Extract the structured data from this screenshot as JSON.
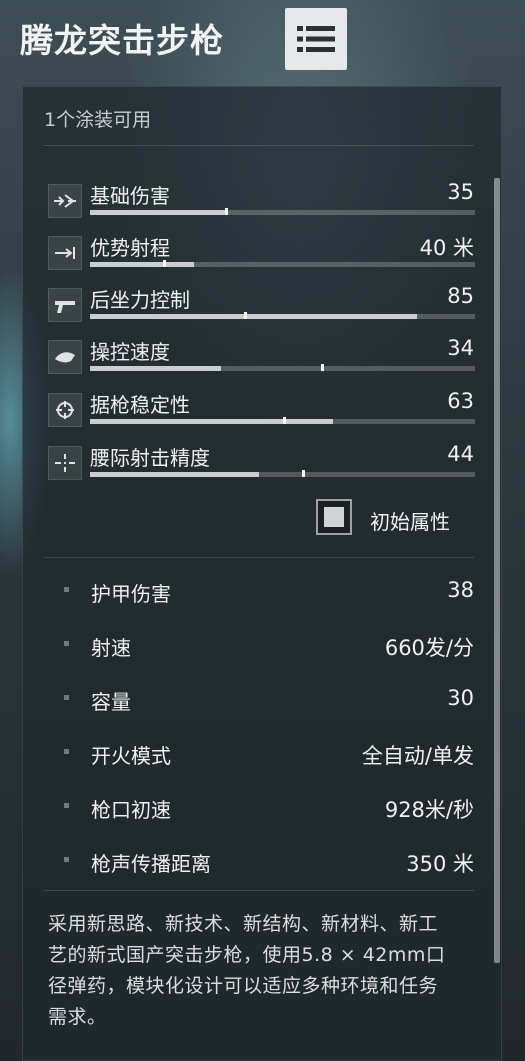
{
  "title": "腾龙突击步枪",
  "list_button_icon": "list-icon",
  "skins_available": "1个涂装可用",
  "stats": [
    {
      "icon": "damage-icon",
      "label": "基础伤害",
      "value": "35",
      "fill": 0.35,
      "base": 0.35
    },
    {
      "icon": "range-icon",
      "label": "优势射程",
      "value": "40 米",
      "fill": 0.27,
      "base": 0.19
    },
    {
      "icon": "recoil-icon",
      "label": "后坐力控制",
      "value": "85",
      "fill": 0.85,
      "base": 0.4
    },
    {
      "icon": "handling-icon",
      "label": "操控速度",
      "value": "34",
      "fill": 0.34,
      "base": 0.6
    },
    {
      "icon": "stability-icon",
      "label": "据枪稳定性",
      "value": "63",
      "fill": 0.63,
      "base": 0.5
    },
    {
      "icon": "hipfire-icon",
      "label": "腰际射击精度",
      "value": "44",
      "fill": 0.44,
      "base": 0.55
    }
  ],
  "base_toggle_label": "初始属性",
  "attributes": [
    {
      "label": "护甲伤害",
      "value": "38"
    },
    {
      "label": "射速",
      "value": "660发/分"
    },
    {
      "label": "容量",
      "value": "30"
    },
    {
      "label": "开火模式",
      "value": "全自动/单发"
    },
    {
      "label": "枪口初速",
      "value": "928米/秒"
    },
    {
      "label": "枪声传播距离",
      "value": "350 米"
    }
  ],
  "description": "采用新思路、新技术、新结构、新材料、新工艺的新式国产突击步枪，使用5.8 × 42mm口径弹药，模块化设计可以适应多种环境和任务需求。"
}
